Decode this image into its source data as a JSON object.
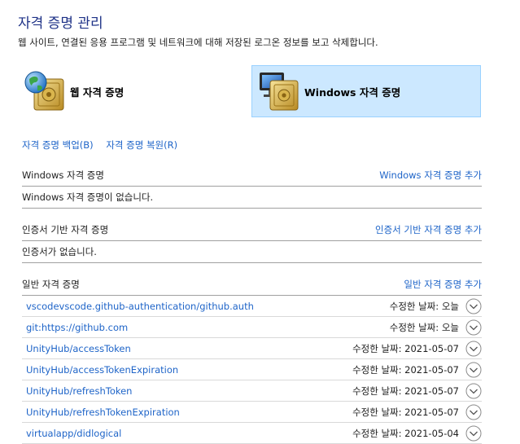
{
  "header": {
    "title": "자격 증명 관리",
    "subtitle": "웹 사이트, 연결된 응용 프로그램 및 네트워크에 대해 저장된 로그온 정보를 보고 삭제합니다."
  },
  "credential_types": {
    "web_label": "웹 자격 증명",
    "windows_label": "Windows 자격 증명"
  },
  "backup_links": {
    "backup": "자격 증명 백업(B)",
    "restore": "자격 증명 복원(R)"
  },
  "windows_section": {
    "heading": "Windows 자격 증명",
    "add_link": "Windows 자격 증명 추가",
    "empty_text": "Windows 자격 증명이 없습니다."
  },
  "certificate_section": {
    "heading": "인증서 기반 자격 증명",
    "add_link": "인증서 기반 자격 증명 추가",
    "empty_text": "인증서가 없습니다."
  },
  "generic_section": {
    "heading": "일반 자격 증명",
    "add_link": "일반 자격 증명 추가",
    "items": [
      {
        "name": "vscodevscode.github-authentication/github.auth",
        "modified": "수정한 날짜:  오늘"
      },
      {
        "name": "git:https://github.com",
        "modified": "수정한 날짜:  오늘"
      },
      {
        "name": "UnityHub/accessToken",
        "modified": "수정한 날짜:  2021-05-07"
      },
      {
        "name": "UnityHub/accessTokenExpiration",
        "modified": "수정한 날짜:  2021-05-07"
      },
      {
        "name": "UnityHub/refreshToken",
        "modified": "수정한 날짜:  2021-05-07"
      },
      {
        "name": "UnityHub/refreshTokenExpiration",
        "modified": "수정한 날짜:  2021-05-07"
      },
      {
        "name": "virtualapp/didlogical",
        "modified": "수정한 날짜:  2021-05-04"
      }
    ]
  },
  "colors": {
    "title": "#1e3287",
    "link": "#1e64c8",
    "selected_bg": "#cce8ff",
    "selected_border": "#99d1ff"
  }
}
